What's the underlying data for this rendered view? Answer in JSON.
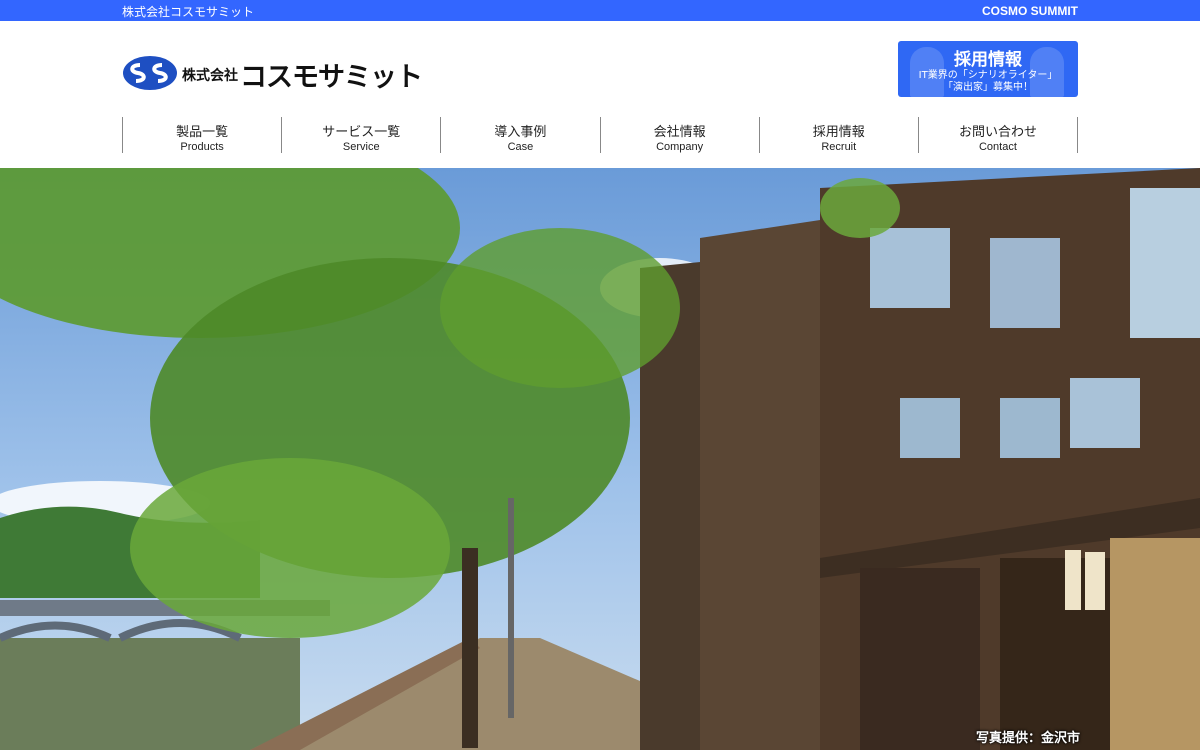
{
  "topbar": {
    "company_name": "株式会社コスモサミット",
    "brand_en": "COSMO SUMMIT"
  },
  "logo": {
    "prefix": "株式会社",
    "name": "コスモサミット",
    "icon": "cs-logo-icon"
  },
  "recruit_banner": {
    "title": "採用情報",
    "line1": "IT業界の「シナリオライター」",
    "line2": "「演出家」募集中！"
  },
  "nav": {
    "items": [
      {
        "jp": "製品一覧",
        "en": "Products"
      },
      {
        "jp": "サービス一覧",
        "en": "Service"
      },
      {
        "jp": "導入事例",
        "en": "Case"
      },
      {
        "jp": "会社情報",
        "en": "Company"
      },
      {
        "jp": "採用情報",
        "en": "Recruit"
      },
      {
        "jp": "お問い合わせ",
        "en": "Contact"
      }
    ]
  },
  "hero": {
    "credit": "写真提供：金沢市"
  },
  "colors": {
    "accent": "#3366ff",
    "banner": "#2f68f4",
    "logo_blue": "#1e4fc2"
  }
}
